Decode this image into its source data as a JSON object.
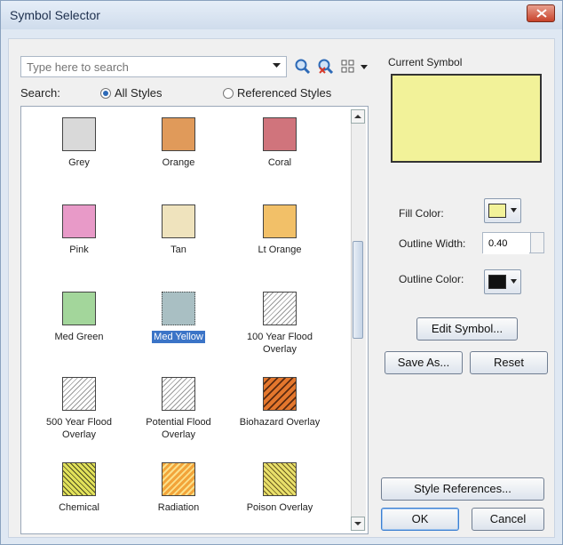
{
  "window": {
    "title": "Symbol Selector"
  },
  "search": {
    "placeholder": "Type here to search"
  },
  "search_scope": {
    "label": "Search:",
    "options": [
      {
        "label": "All Styles",
        "selected": true
      },
      {
        "label": "Referenced Styles",
        "selected": false
      }
    ]
  },
  "symbols": [
    {
      "label": "Grey",
      "color": "#d9d9d9"
    },
    {
      "label": "Orange",
      "color": "#e09a5a"
    },
    {
      "label": "Coral",
      "color": "#d0747c"
    },
    {
      "label": "Pink",
      "color": "#e89ac8"
    },
    {
      "label": "Tan",
      "color": "#efe3bd"
    },
    {
      "label": "Lt Orange",
      "color": "#f2c068"
    },
    {
      "label": "Med Green",
      "color": "#a3d69b"
    },
    {
      "label": "Med Yellow",
      "color": "#a9bfc3",
      "selected": true
    },
    {
      "label": "100 Year Flood Overlay",
      "pattern": "hatch"
    },
    {
      "label": "500 Year Flood Overlay",
      "pattern": "hatch"
    },
    {
      "label": "Potential Flood Overlay",
      "pattern": "hatch"
    },
    {
      "label": "Biohazard Overlay",
      "pattern": "biohazard",
      "color": "#e4772d"
    },
    {
      "label": "Chemical",
      "pattern": "chemical",
      "color": "#e2e25a"
    },
    {
      "label": "Radiation",
      "pattern": "radiation",
      "color": "#f2a43a"
    },
    {
      "label": "Poison Overlay",
      "pattern": "poison",
      "color": "#e9e06a"
    }
  ],
  "current_symbol": {
    "label": "Current Symbol",
    "fill": "#f2f299",
    "fill_color_label": "Fill Color:",
    "outline_width_label": "Outline Width:",
    "outline_width": "0.40",
    "outline_color_label": "Outline Color:",
    "outline_color": "#111111"
  },
  "buttons": {
    "edit_symbol": "Edit Symbol...",
    "save_as": "Save As...",
    "reset": "Reset",
    "style_references": "Style References...",
    "ok": "OK",
    "cancel": "Cancel"
  }
}
